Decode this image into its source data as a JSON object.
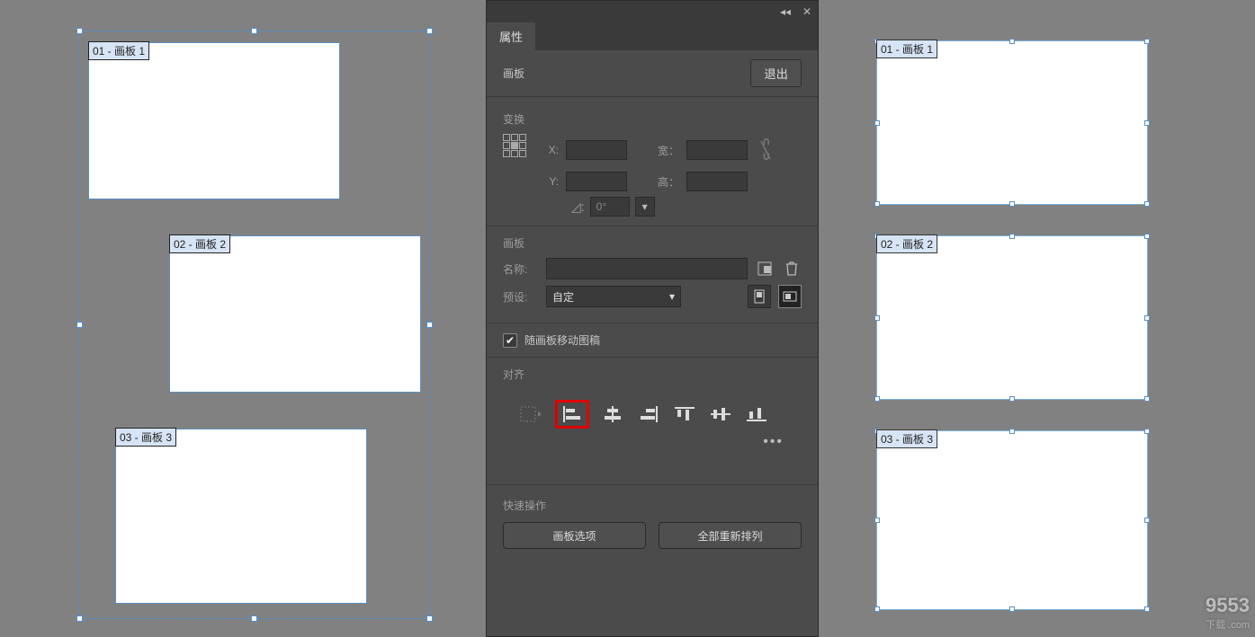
{
  "panel": {
    "tab_title": "属性",
    "obj_type_label": "画板",
    "exit_label": "退出",
    "transform": {
      "title": "变换",
      "x_label": "X:",
      "y_label": "Y:",
      "w_label": "宽：",
      "h_label": "高：",
      "x": "",
      "y": "",
      "w": "",
      "h": "",
      "rot_value": "0°"
    },
    "artboard_section": {
      "title": "画板",
      "name_label": "名称:",
      "name_value": "",
      "preset_label": "预设:",
      "preset_value": "自定"
    },
    "move_with_artboard_label": "随画板移动图稿",
    "align_title": "对齐",
    "quick_title": "快速操作",
    "quick_btn1": "画板选项",
    "quick_btn2": "全部重新排列"
  },
  "left_artboards": [
    {
      "label": "01 - 画板 1"
    },
    {
      "label": "02 - 画板 2"
    },
    {
      "label": "03 - 画板 3"
    }
  ],
  "right_artboards": [
    {
      "label": "01 - 画板 1"
    },
    {
      "label": "02 - 画板 2"
    },
    {
      "label": "03 - 画板 3"
    }
  ],
  "watermark": {
    "brand": "9553",
    "sub": "下载 .com"
  }
}
